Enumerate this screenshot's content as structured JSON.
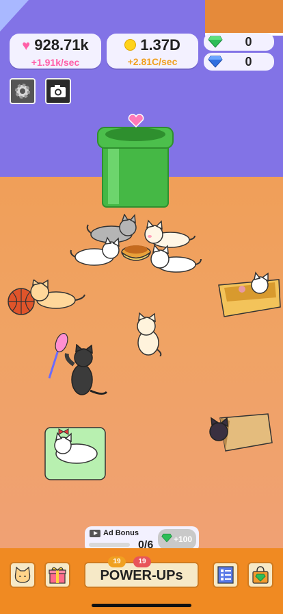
{
  "stats": {
    "hearts": {
      "value": "928.71k",
      "rate": "+1.91k/sec",
      "icon": "heart-icon",
      "color": "#ff5fa8"
    },
    "coins": {
      "value": "1.37D",
      "rate": "+2.81C/sec",
      "icon": "coin-icon",
      "color": "#ffb233"
    }
  },
  "gems": {
    "green": "0",
    "blue": "0"
  },
  "toolbar": {
    "settings_icon": "gear-icon",
    "camera_icon": "camera-icon"
  },
  "ad_bonus": {
    "label": "Ad Bonus",
    "progress": "0/6",
    "progress_fraction": 0,
    "reward": "+100"
  },
  "bottom": {
    "power_ups_label": "POWER-UPs",
    "badge_left": "19",
    "badge_right": "19"
  },
  "colors": {
    "wall": "#8273e6",
    "floor": "#ef9a4c",
    "pipe": "#4cbf4c",
    "bar": "#f08a22"
  }
}
